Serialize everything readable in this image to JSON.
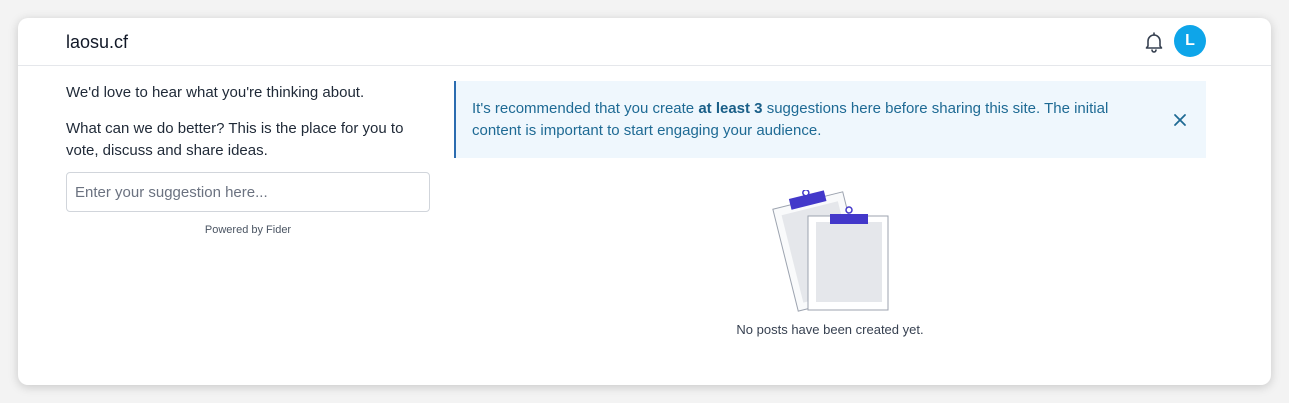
{
  "header": {
    "site_title": "laosu.cf",
    "bell_icon": "bell-icon",
    "avatar_initial": "L",
    "avatar_color": "#0ea5e9"
  },
  "left": {
    "intro_line_1": "We'd love to hear what you're thinking about.",
    "intro_line_2": "What can we do better? This is the place for you to vote, discuss and share ideas.",
    "suggestion_placeholder": "Enter your suggestion here...",
    "powered_by": "Powered by Fider"
  },
  "notice": {
    "text_before": "It's recommended that you create ",
    "text_bold": "at least 3",
    "text_after": " suggestions here before sharing this site. The initial content is important to start engaging your audience.",
    "close_icon": "close-icon",
    "accent_color": "#2b6cb0",
    "background": "#eff7fd"
  },
  "empty_state": {
    "illustration": "clipboards-illustration",
    "message": "No posts have been created yet."
  }
}
